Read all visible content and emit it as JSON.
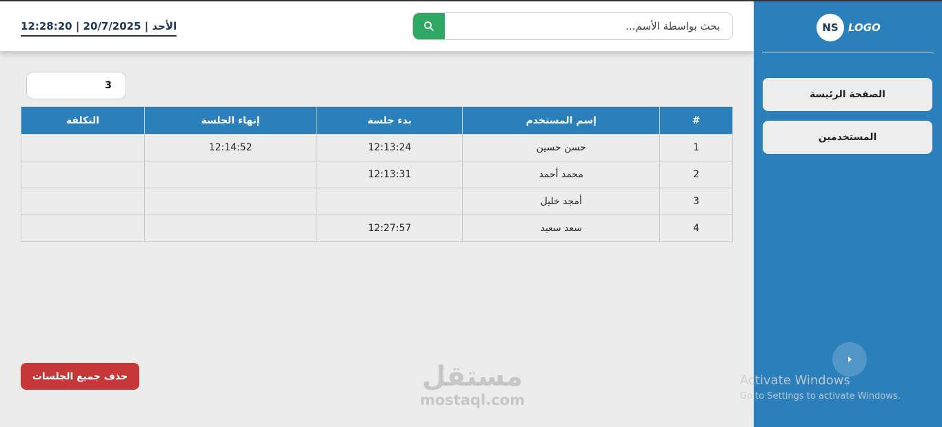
{
  "header": {
    "datetime": "12:28:20 | 20/7/2025 | الأحد",
    "search_placeholder": "بحث بواسطة الأسم..."
  },
  "sidebar": {
    "logo_initials": "NS",
    "logo_text": "LOGO",
    "items": [
      {
        "label": "الصفحة الرئيسة"
      },
      {
        "label": "المستخدمين"
      }
    ]
  },
  "main": {
    "count_value": "3",
    "table": {
      "headers": [
        "#",
        "إسم المستخدم",
        "بدء جلسة",
        "إنهاء الجلسة",
        "التكلفة"
      ],
      "rows": [
        {
          "num": "1",
          "name": "حسن حسين",
          "start": "12:13:24",
          "end": "12:14:52",
          "cost": ""
        },
        {
          "num": "2",
          "name": "محمد أحمد",
          "start": "12:13:31",
          "end": "",
          "cost": ""
        },
        {
          "num": "3",
          "name": "أمجد خليل",
          "start": "",
          "end": "",
          "cost": ""
        },
        {
          "num": "4",
          "name": "سعد سعيد",
          "start": "12:27:57",
          "end": "",
          "cost": ""
        }
      ]
    },
    "delete_all_label": "حذف جميع الجلسات"
  },
  "watermark": {
    "arabic": "مستقل",
    "latin": "mostaql.com"
  },
  "os_overlay": {
    "title": "Activate Windows",
    "subtitle": "Go to Settings to activate Windows."
  },
  "colors": {
    "sidebar": "#2b7fba",
    "search_button": "#2ea863",
    "delete_button": "#c6373a",
    "table_header": "#2b7fba"
  }
}
